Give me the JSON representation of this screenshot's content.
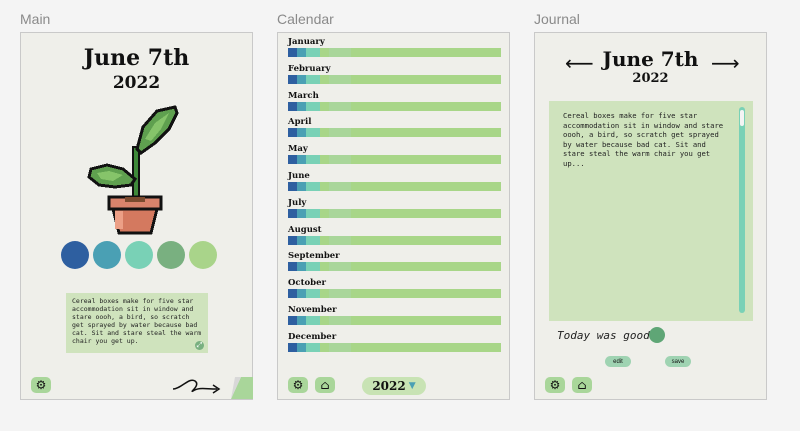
{
  "frames": {
    "main": "Main",
    "calendar": "Calendar",
    "journal": "Journal"
  },
  "main": {
    "date": "June 7th",
    "year": "2022",
    "swatches": [
      "#2e5fa0",
      "#4aa0b4",
      "#79d1b6",
      "#79b080",
      "#a9d48a"
    ],
    "note": "Cereal boxes make for five star accommodation sit in window and stare oooh, a bird, so scratch get sprayed by water because bad cat. Sit and stare steal the warm chair you get up."
  },
  "calendar": {
    "months": [
      "January",
      "February",
      "March",
      "April",
      "May",
      "June",
      "July",
      "August",
      "September",
      "October",
      "November",
      "December"
    ],
    "segment_colors": [
      "#2e5fa0",
      "#4aa0b4",
      "#79d1b6"
    ],
    "year": "2022"
  },
  "journal": {
    "date": "June 7th",
    "year": "2022",
    "entry": "Cereal boxes make for five star accommodation sit in window and stare oooh, a bird, so scratch get sprayed by water because bad cat. Sit and stare steal the warm chair you get up...",
    "mood_text": "Today was good",
    "mood_color": "#5fa676",
    "edit_label": "edit",
    "save_label": "save"
  },
  "colors": {
    "accent_green": "#a9d69a",
    "panel_green": "#cfe3bd",
    "scroll_thumb": "#79d1b6"
  }
}
